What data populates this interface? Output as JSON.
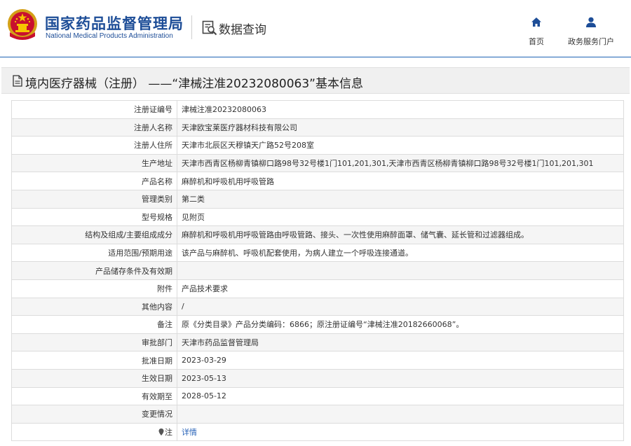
{
  "header": {
    "org_cn": "国家药品监督管理局",
    "org_en": "National Medical Products Administration",
    "section_label": "数据查询",
    "nav": [
      {
        "label": "首页",
        "icon": "home-icon"
      },
      {
        "label": "政务服务门户",
        "icon": "user-icon"
      }
    ]
  },
  "title": "境内医疗器械（注册） ——“津械注准20232080063”基本信息",
  "rows": [
    {
      "key": "注册证编号",
      "value": "津械注准20232080063"
    },
    {
      "key": "注册人名称",
      "value": "天津欧宝莱医疗器材科技有限公司"
    },
    {
      "key": "注册人住所",
      "value": "天津市北辰区天穆镇天广路52号208室"
    },
    {
      "key": "生产地址",
      "value": "天津市西青区杨柳青镇柳口路98号32号楼1门101,201,301,天津市西青区杨柳青镇柳口路98号32号楼1门101,201,301"
    },
    {
      "key": "产品名称",
      "value": "麻醉机和呼吸机用呼吸管路"
    },
    {
      "key": "管理类别",
      "value": "第二类"
    },
    {
      "key": "型号规格",
      "value": "见附页"
    },
    {
      "key": "结构及组成/主要组成成分",
      "value": "麻醉机和呼吸机用呼吸管路由呼吸管路、接头、一次性使用麻醉面罩、储气囊、延长管和过滤器组成。"
    },
    {
      "key": "适用范围/预期用途",
      "value": "该产品与麻醉机、呼吸机配套使用，为病人建立一个呼吸连接通道。"
    },
    {
      "key": "产品储存条件及有效期",
      "value": ""
    },
    {
      "key": "附件",
      "value": "产品技术要求"
    },
    {
      "key": "其他内容",
      "value": "/"
    },
    {
      "key": "备注",
      "value": "原《分类目录》产品分类编码：6866；原注册证编号“津械注准20182660068”。"
    },
    {
      "key": "审批部门",
      "value": "天津市药品监督管理局"
    },
    {
      "key": "批准日期",
      "value": "2023-03-29"
    },
    {
      "key": "生效日期",
      "value": "2023-05-13"
    },
    {
      "key": "有效期至",
      "value": "2028-05-12"
    },
    {
      "key": "变更情况",
      "value": ""
    },
    {
      "key": "注",
      "value": "详情",
      "key_icon": "pin-icon",
      "link": true
    }
  ]
}
